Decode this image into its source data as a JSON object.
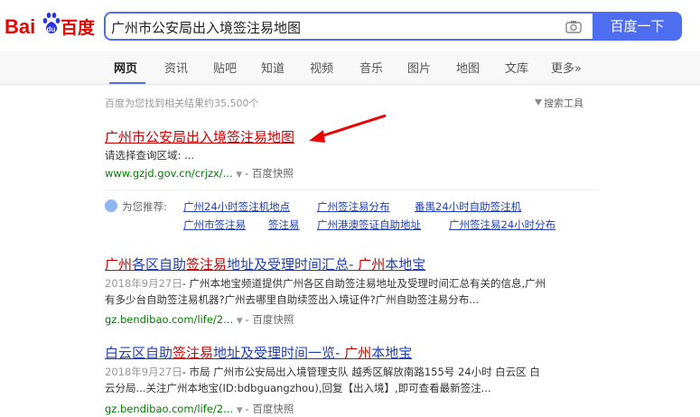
{
  "logo": {
    "text_left": "Bai",
    "text_mid": "du",
    "text_right": "百度",
    "colors": {
      "red": "#e10602",
      "blue": "#2932e1"
    }
  },
  "search": {
    "query": "广州市公安局出入境签注易地图",
    "button_label": "百度一下"
  },
  "tabs": [
    {
      "label": "网页",
      "active": true
    },
    {
      "label": "资讯"
    },
    {
      "label": "贴吧"
    },
    {
      "label": "知道"
    },
    {
      "label": "视频"
    },
    {
      "label": "音乐"
    },
    {
      "label": "图片"
    },
    {
      "label": "地图"
    },
    {
      "label": "文库"
    },
    {
      "label": "更多»"
    }
  ],
  "result_count": "百度为您找到相关结果约35,500个",
  "search_tools": "搜索工具",
  "results": [
    {
      "title": "广州市公安局出入境签注易地图",
      "abstract": "请选择查询区域: ...",
      "url": "www.gzjd.gov.cn/crjzx/...",
      "snapshot": "百度快照"
    },
    {
      "title_parts": [
        "广州",
        "各区自助",
        "签注易",
        "地址及受理时间汇总- ",
        "广州",
        "本地宝"
      ],
      "date": "2018年9月27日",
      "abstract_line1": "- 广州本地宝频道提供广州各区自助签注易地址及受理时间汇总有关的信息,广州",
      "abstract_line2": "有多少台自助签注易机器?广州去哪里自助续签出入境证件?广州自助签注易分布...",
      "url": "gz.bendibao.com/life/2...",
      "snapshot": "百度快照"
    },
    {
      "title_parts": [
        "白云区自助",
        "签注易",
        "地址及受理时间一览- ",
        "广州",
        "本地宝"
      ],
      "date": "2018年9月27日",
      "abstract_line1": "- 市局 广州市公安局出入境管理支队 越秀区解放南路155号 24小时 白云区 白",
      "abstract_line2": "云分局...关注广州本地宝(ID:bdbguangzhou),回复【出入境】,即可查看最新签注...",
      "url": "gz.bendibao.com/life/2...",
      "snapshot": "百度快照"
    }
  ],
  "recommend": {
    "label": "为您推荐:",
    "links": [
      "广州24小时签注机地点",
      "广州签注易分布",
      "番禺24小时自助签注机",
      "广州市签注易",
      "签注易",
      "广州港澳签证自助地址",
      "广州签注易24小时分布"
    ]
  }
}
